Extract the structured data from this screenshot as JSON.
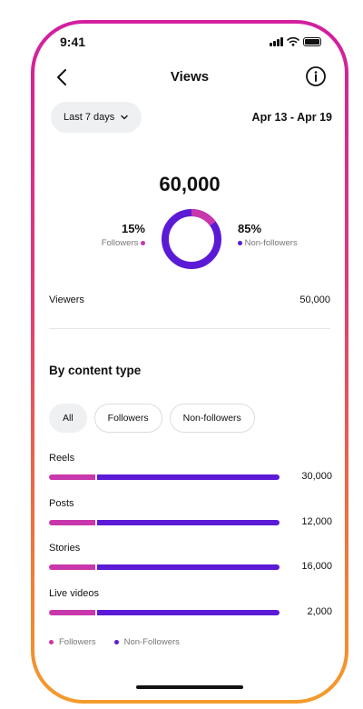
{
  "status_bar": {
    "time": "9:41"
  },
  "header": {
    "title": "Views"
  },
  "date_filter": {
    "label": "Last 7 days",
    "range": "Apr 13 - Apr 19"
  },
  "summary": {
    "total": "60,000",
    "followers": {
      "percent": "15%",
      "label": "Followers",
      "fraction": 0.15
    },
    "non_followers": {
      "percent": "85%",
      "label": "Non-followers",
      "fraction": 0.85
    },
    "viewers": {
      "label": "Viewers",
      "value": "50,000"
    }
  },
  "content_section": {
    "title": "By content type",
    "filters": [
      "All",
      "Followers",
      "Non-followers"
    ],
    "active_filter": "All",
    "rows": [
      {
        "label": "Reels",
        "value": "30,000",
        "followers_fraction": 0.2
      },
      {
        "label": "Posts",
        "value": "12,000",
        "followers_fraction": 0.2
      },
      {
        "label": "Stories",
        "value": "16,000",
        "followers_fraction": 0.2
      },
      {
        "label": "Live videos",
        "value": "2,000",
        "followers_fraction": 0.2
      }
    ],
    "legend": {
      "followers": "Followers",
      "non_followers": "Non-Followers"
    }
  },
  "colors": {
    "followers": "#c837ab",
    "non_followers": "#5b1bd6",
    "frame_top": "#d21fa0",
    "frame_bottom": "#f59b2c"
  },
  "icons": {
    "back": "chevron-left-icon",
    "info": "info-icon",
    "dropdown": "chevron-down-icon"
  }
}
